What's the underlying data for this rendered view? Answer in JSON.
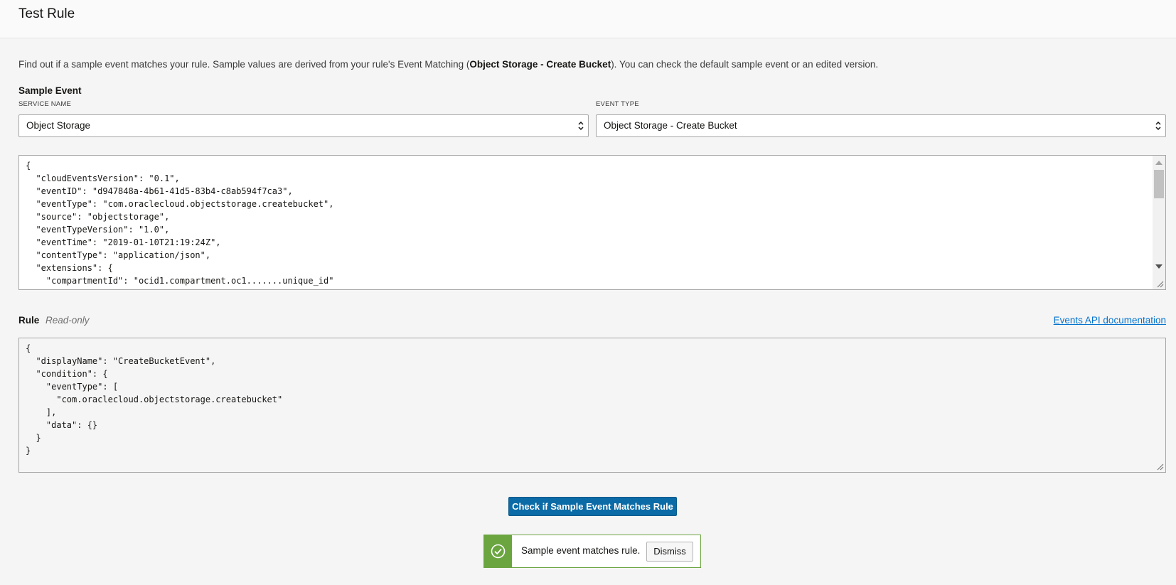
{
  "header": {
    "title": "Test Rule"
  },
  "description": {
    "before": "Find out if a sample event matches your rule. Sample values are derived from your rule's Event Matching (",
    "bold": "Object Storage - Create Bucket",
    "after": "). You can check the default sample event or an edited version."
  },
  "sample_event": {
    "heading": "Sample Event",
    "service_name": {
      "label": "SERVICE NAME",
      "value": "Object Storage",
      "icon": "chevron-updown-icon"
    },
    "event_type": {
      "label": "EVENT TYPE",
      "value": "Object Storage - Create Bucket",
      "icon": "chevron-updown-icon"
    },
    "json_lines": [
      "{",
      "  \"cloudEventsVersion\": \"0.1\",",
      "  \"eventID\": \"d947848a-4b61-41d5-83b4-c8ab594f7ca3\",",
      "  \"eventType\": \"com.oraclecloud.objectstorage.createbucket\",",
      "  \"source\": \"objectstorage\",",
      "  \"eventTypeVersion\": \"1.0\",",
      "  \"eventTime\": \"2019-01-10T21:19:24Z\",",
      "  \"contentType\": \"application/json\",",
      "  \"extensions\": {",
      "    \"compartmentId\": \"ocid1.compartment.oc1.......unique_id\"",
      "  },"
    ]
  },
  "rule": {
    "label": "Rule",
    "readonly_label": "Read-only",
    "doc_link": "Events API documentation",
    "json_lines": [
      "{",
      "  \"displayName\": \"CreateBucketEvent\",",
      "  \"condition\": {",
      "    \"eventType\": [",
      "      \"com.oraclecloud.objectstorage.createbucket\"",
      "    ],",
      "    \"data\": {}",
      "  }",
      "}"
    ]
  },
  "actions": {
    "check_button": "Check if Sample Event Matches Rule"
  },
  "result": {
    "message": "Sample event matches rule.",
    "dismiss_label": "Dismiss",
    "icon": "check-circle-icon",
    "status_color": "#6ba540"
  },
  "colors": {
    "primary_button": "#0a6ba6",
    "link": "#0572ce",
    "success": "#6ba540"
  }
}
